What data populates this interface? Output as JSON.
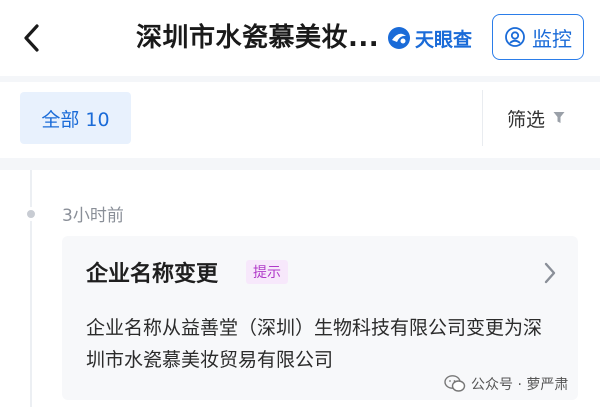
{
  "header": {
    "title": "深圳市水瓷慕美妆...",
    "brand_name": "天眼查",
    "monitor_label": "监控",
    "back_icon": "chevron-left-icon"
  },
  "filterbar": {
    "tab_all_label": "全部 10",
    "filter_label": "筛选"
  },
  "timeline": {
    "entries": [
      {
        "time": "3小时前",
        "title": "企业名称变更",
        "tag": "提示",
        "body": "企业名称从益善堂（深圳）生物科技有限公司变更为深圳市水瓷慕美妆贸易有限公司"
      }
    ]
  },
  "watermark": {
    "text": "公众号 · 萝严肃"
  },
  "colors": {
    "accent": "#1a6bd8",
    "tag_text": "#b03ac9",
    "tag_bg": "#f7e8fb",
    "card_bg": "#f7f8fa",
    "band_bg": "#f4f6f9"
  }
}
